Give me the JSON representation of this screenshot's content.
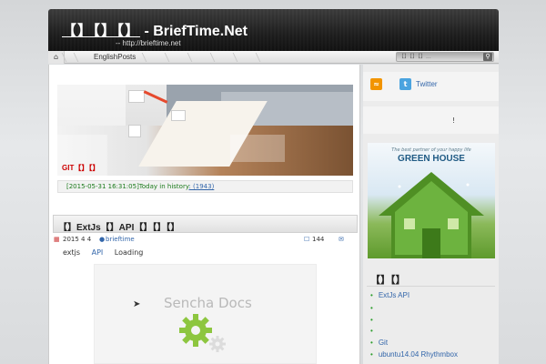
{
  "header": {
    "title_cn": "【】【】【】",
    "title_sep": " - ",
    "title_en": "BriefTime.Net",
    "url": "-- http://brieftime.net"
  },
  "nav": {
    "home_icon": "home-icon",
    "items": [
      "EnglishPosts"
    ],
    "search_placeholder": "【】【】【】...",
    "search_icon": "search-icon"
  },
  "slider": {
    "caption": "GIT【】【】"
  },
  "history": {
    "prefix": "[2015-05-31 16:31:05]Today in history",
    "link": ":         (1943)"
  },
  "post": {
    "title": "【】ExtJs【】API【】【】【】",
    "date": "2015 4 4",
    "author": "brieftime",
    "views": "144",
    "tags": [
      "extjs",
      "API",
      "Loading"
    ]
  },
  "docs": {
    "title": "Sencha Docs"
  },
  "sidebar": {
    "twitter": "Twitter",
    "notice": "!",
    "ad_tagline": "The best partner of your happy life",
    "ad_title": "GREEN HOUSE",
    "heading": "【】【】",
    "list": [
      "ExtJs  API",
      "",
      "",
      "",
      "Git",
      "ubuntu14.04 Rhythmbox"
    ]
  },
  "colors": {
    "accent_green": "#2e9e2e",
    "link_blue": "#3366aa",
    "header_dark": "#1e1e1e"
  }
}
